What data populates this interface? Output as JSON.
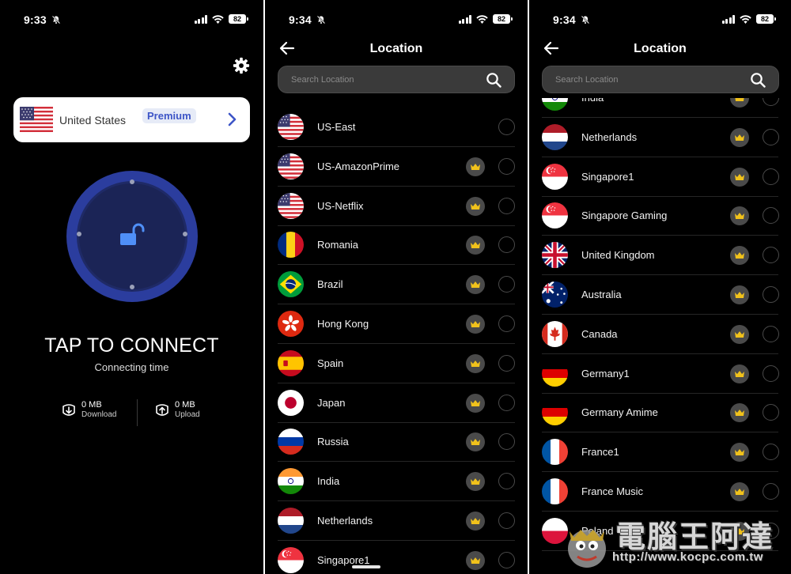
{
  "colors": {
    "background": "#000000",
    "ring": "#2b3d9e",
    "dial": "#1f2a66",
    "accent": "#3d55c7",
    "lock": "#4f8ff7",
    "crown": "#f1c21b",
    "badge_bg": "#4a4a4a"
  },
  "screen_connect": {
    "status": {
      "time": "9:33",
      "battery": "82"
    },
    "selected_location": {
      "name": "United States",
      "badge": "Premium",
      "flag": "us"
    },
    "tap_label": "TAP TO CONNECT",
    "connecting_label": "Connecting time",
    "download": {
      "value": "0 MB",
      "label": "Download"
    },
    "upload": {
      "value": "0 MB",
      "label": "Upload"
    }
  },
  "screen_list_1": {
    "status": {
      "time": "9:34",
      "battery": "82"
    },
    "title": "Location",
    "search_placeholder": "Search Location",
    "items": [
      {
        "name": "US-East",
        "flag": "us",
        "premium": false
      },
      {
        "name": "US-AmazonPrime",
        "flag": "us",
        "premium": true
      },
      {
        "name": "US-Netflix",
        "flag": "us",
        "premium": true
      },
      {
        "name": "Romania",
        "flag": "ro",
        "premium": true
      },
      {
        "name": "Brazil",
        "flag": "br",
        "premium": true
      },
      {
        "name": "Hong Kong",
        "flag": "hk",
        "premium": true
      },
      {
        "name": "Spain",
        "flag": "es",
        "premium": true
      },
      {
        "name": "Japan",
        "flag": "jp",
        "premium": true
      },
      {
        "name": "Russia",
        "flag": "ru",
        "premium": true
      },
      {
        "name": "India",
        "flag": "in",
        "premium": true
      },
      {
        "name": "Netherlands",
        "flag": "nl",
        "premium": true
      },
      {
        "name": "Singapore1",
        "flag": "sg",
        "premium": true
      }
    ]
  },
  "screen_list_2": {
    "status": {
      "time": "9:34",
      "battery": "82"
    },
    "title": "Location",
    "search_placeholder": "Search Location",
    "items": [
      {
        "name": "India",
        "flag": "in",
        "premium": true
      },
      {
        "name": "Netherlands",
        "flag": "nl",
        "premium": true
      },
      {
        "name": "Singapore1",
        "flag": "sg",
        "premium": true
      },
      {
        "name": "Singapore Gaming",
        "flag": "sg",
        "premium": true
      },
      {
        "name": "United Kingdom",
        "flag": "gb",
        "premium": true
      },
      {
        "name": "Australia",
        "flag": "au",
        "premium": true
      },
      {
        "name": "Canada",
        "flag": "ca",
        "premium": true
      },
      {
        "name": "Germany1",
        "flag": "de",
        "premium": true
      },
      {
        "name": "Germany Amime",
        "flag": "de",
        "premium": true
      },
      {
        "name": "France1",
        "flag": "fr",
        "premium": true
      },
      {
        "name": "France Music",
        "flag": "fr",
        "premium": true
      },
      {
        "name": "Poland",
        "flag": "pl",
        "premium": true
      }
    ]
  },
  "watermark": {
    "title": "電腦王阿達",
    "url": "http://www.kocpc.com.tw"
  }
}
